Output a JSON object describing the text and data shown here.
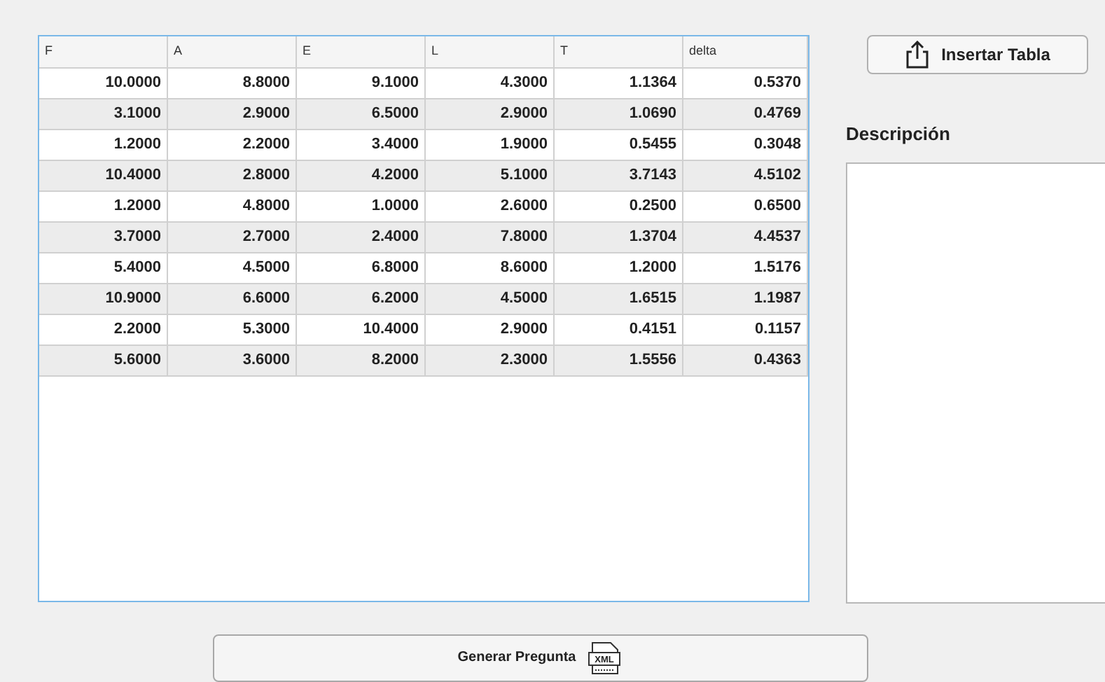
{
  "table": {
    "columns": [
      "F",
      "A",
      "E",
      "L",
      "T",
      "delta"
    ],
    "rows": [
      [
        "10.0000",
        "8.8000",
        "9.1000",
        "4.3000",
        "1.1364",
        "0.5370"
      ],
      [
        "3.1000",
        "2.9000",
        "6.5000",
        "2.9000",
        "1.0690",
        "0.4769"
      ],
      [
        "1.2000",
        "2.2000",
        "3.4000",
        "1.9000",
        "0.5455",
        "0.3048"
      ],
      [
        "10.4000",
        "2.8000",
        "4.2000",
        "5.1000",
        "3.7143",
        "4.5102"
      ],
      [
        "1.2000",
        "4.8000",
        "1.0000",
        "2.6000",
        "0.2500",
        "0.6500"
      ],
      [
        "3.7000",
        "2.7000",
        "2.4000",
        "7.8000",
        "1.3704",
        "4.4537"
      ],
      [
        "5.4000",
        "4.5000",
        "6.8000",
        "8.6000",
        "1.2000",
        "1.5176"
      ],
      [
        "10.9000",
        "6.6000",
        "6.2000",
        "4.5000",
        "1.6515",
        "1.1987"
      ],
      [
        "2.2000",
        "5.3000",
        "10.4000",
        "2.9000",
        "0.4151",
        "0.1157"
      ],
      [
        "5.6000",
        "3.6000",
        "8.2000",
        "2.3000",
        "1.5556",
        "0.4363"
      ]
    ]
  },
  "insert_button": {
    "label": "Insertar Tabla"
  },
  "description": {
    "label": "Descripción"
  },
  "generate_button": {
    "label": "Generar Pregunta",
    "icon_text": "XML"
  }
}
